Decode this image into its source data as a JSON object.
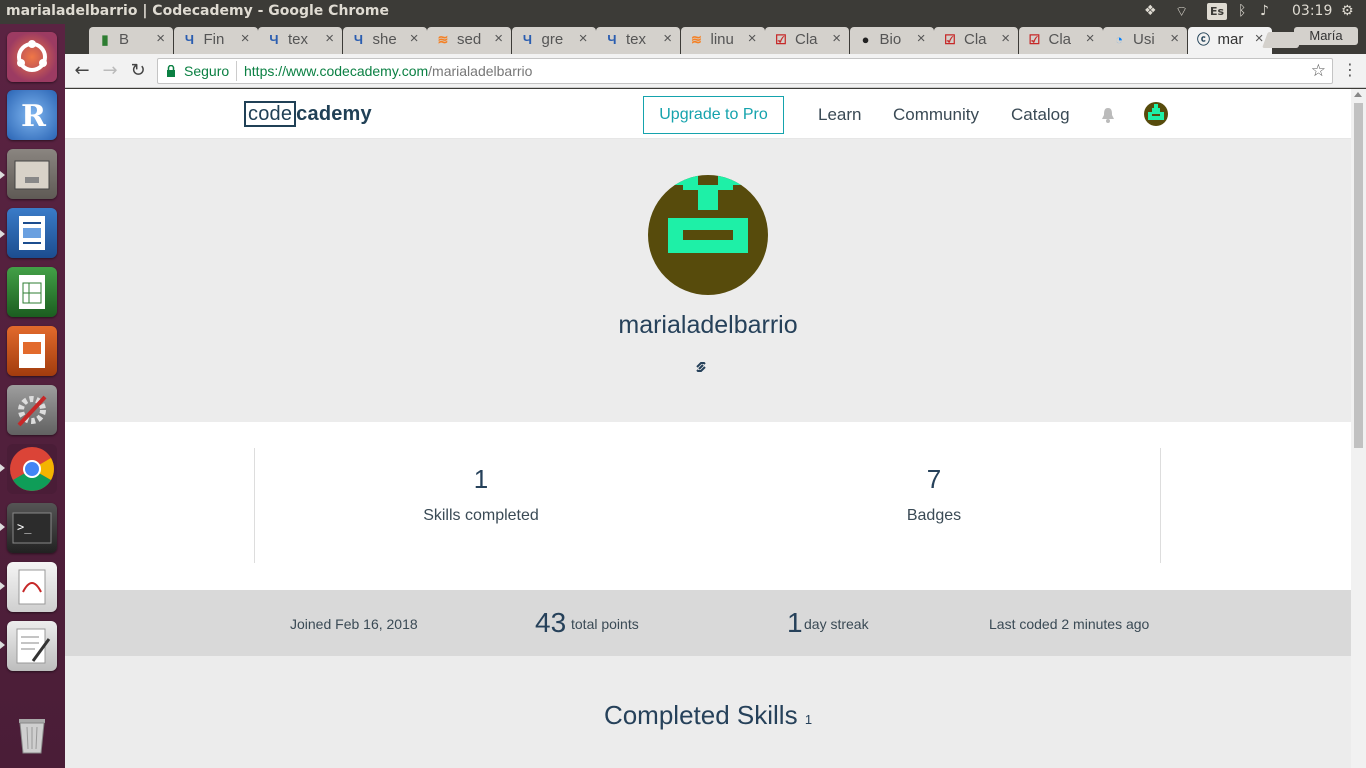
{
  "os": {
    "window_title": "marialadelbarrio | Codecademy - Google Chrome",
    "keyboard_layout": "Es",
    "clock": "03:19",
    "user": "María"
  },
  "browser": {
    "tabs": [
      {
        "icon": "progress-icon",
        "title": "B"
      },
      {
        "icon": "unix-se-icon",
        "title": "Fin"
      },
      {
        "icon": "unix-se-icon",
        "title": "tex"
      },
      {
        "icon": "unix-se-icon",
        "title": "she"
      },
      {
        "icon": "stackoverflow-icon",
        "title": "sed"
      },
      {
        "icon": "unix-se-icon",
        "title": "gre"
      },
      {
        "icon": "unix-se-icon",
        "title": "tex"
      },
      {
        "icon": "stackoverflow-icon",
        "title": "linu"
      },
      {
        "icon": "checkbox-icon",
        "title": "Cla"
      },
      {
        "icon": "github-icon",
        "title": "Bio"
      },
      {
        "icon": "checkbox-icon",
        "title": "Cla"
      },
      {
        "icon": "checkbox-icon",
        "title": "Cla"
      },
      {
        "icon": "digitalocean-icon",
        "title": "Usi"
      },
      {
        "icon": "codecademy-icon",
        "title": "mar"
      }
    ],
    "secure_label": "Seguro",
    "url_host": "https://www.codecademy.com",
    "url_path": "/marialadelbarrio"
  },
  "site": {
    "logo_boxed": "code",
    "logo_rest": "cademy",
    "upgrade_label": "Upgrade to Pro",
    "nav": [
      "Learn",
      "Community",
      "Catalog"
    ],
    "accent_color": "#15a3ad"
  },
  "profile": {
    "username": "marialadelbarrio",
    "avatar_colors": {
      "bg": "#574b0c",
      "fg": "#1ef0a7"
    },
    "skills_completed": "1",
    "skills_completed_label": "Skills completed",
    "badges": "7",
    "badges_label": "Badges",
    "joined": "Joined Feb 16, 2018",
    "total_points": "43",
    "total_points_label": "total points",
    "streak": "1",
    "streak_label": "day streak",
    "last_coded": "Last coded 2 minutes ago",
    "completed_title": "Completed Skills",
    "completed_count": "1"
  }
}
